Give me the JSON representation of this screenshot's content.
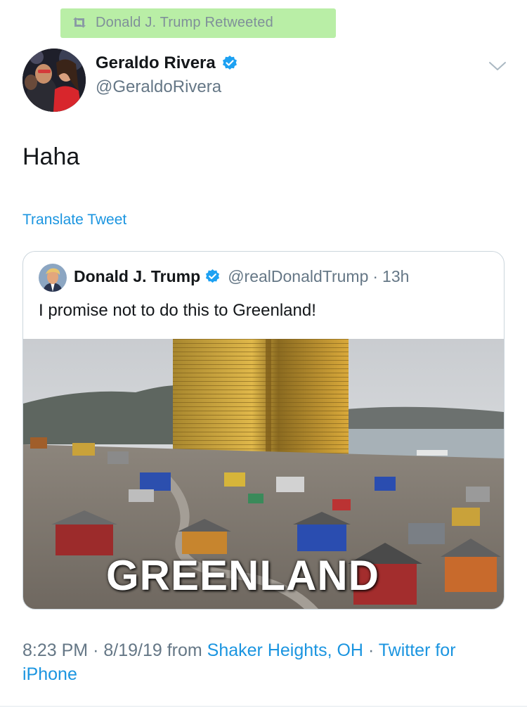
{
  "retweet": {
    "icon": "retweet-icon",
    "label": "Donald J. Trump Retweeted",
    "highlight_color": "#b9eea6"
  },
  "author": {
    "name": "Geraldo Rivera",
    "handle": "@GeraldoRivera",
    "verified": true
  },
  "tweet": {
    "text": "Haha",
    "translate_label": "Translate Tweet"
  },
  "quoted_tweet": {
    "name": "Donald J. Trump",
    "verified": true,
    "handle": "@realDonaldTrump",
    "separator": "·",
    "time": "13h",
    "text": "I promise not to do this to Greenland!",
    "media_caption": "GREENLAND"
  },
  "footer": {
    "time": "8:23 PM",
    "sep1": "·",
    "date": "8/19/19",
    "from": "from",
    "location": "Shaker Heights, OH",
    "sep2": "·",
    "client": "Twitter for iPhone"
  },
  "colors": {
    "link": "#1b95e0",
    "secondary_text": "#657786",
    "verified": "#1da1f2"
  }
}
